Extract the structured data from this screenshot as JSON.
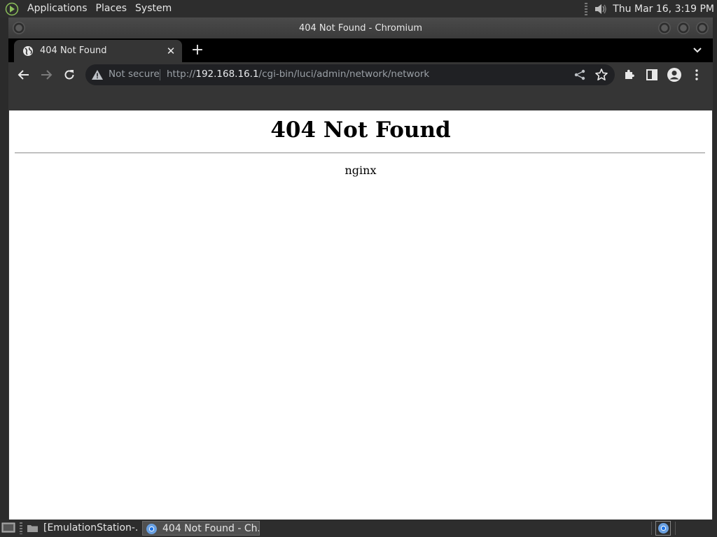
{
  "top_panel": {
    "menu": [
      "Applications",
      "Places",
      "System"
    ],
    "clock": "Thu Mar 16,  3:19 PM"
  },
  "window": {
    "title": "404 Not Found - Chromium"
  },
  "browser": {
    "tab_title": "404 Not Found",
    "tab_close": "✕",
    "new_tab": "+",
    "security_label": "Not secure",
    "url_scheme": "http://",
    "url_host": "192.168.16.1",
    "url_path": "/cgi-bin/luci/admin/network/network"
  },
  "page": {
    "heading": "404 Not Found",
    "server": "nginx"
  },
  "taskbar": {
    "items": [
      {
        "label": "[EmulationStation-..."
      },
      {
        "label": "404 Not Found - Ch..."
      }
    ]
  },
  "colors": {
    "panel_bg": "#2d2d2d",
    "toolbar_bg": "#353535",
    "omnibox_bg": "#202124",
    "chrome_blue": "#1a73e8"
  }
}
